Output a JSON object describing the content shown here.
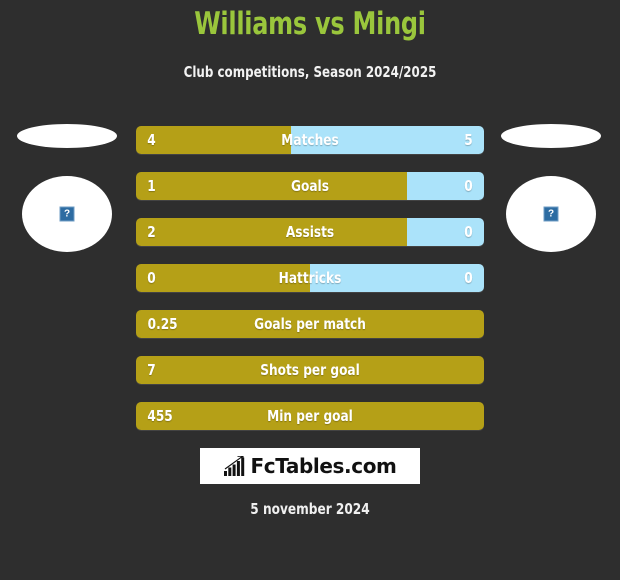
{
  "header": {
    "title": "Williams vs Mingi",
    "subtitle": "Club competitions, Season 2024/2025"
  },
  "colors": {
    "background": "#2e2e2e",
    "title_green": "#9ac63c",
    "bar_gold": "#b5a017",
    "bar_blue": "#abe3fa",
    "text_white": "#ffffff"
  },
  "players": {
    "left": {
      "image_status": "broken-image",
      "icon": "broken-image-icon"
    },
    "right": {
      "image_status": "broken-image",
      "icon": "broken-image-icon"
    }
  },
  "footer": {
    "logo_text": "FcTables.com",
    "logo_icon": "bar-chart-trend-icon",
    "date": "5 november 2024"
  },
  "chart_data": {
    "type": "bar",
    "title": "Williams vs Mingi",
    "subtitle": "Club competitions, Season 2024/2025",
    "orientation": "horizontal-diverging",
    "series": [
      {
        "name": "Williams",
        "color": "#b5a017",
        "side": "left"
      },
      {
        "name": "Mingi",
        "color": "#abe3fa",
        "side": "right"
      }
    ],
    "categories": [
      "Matches",
      "Goals",
      "Assists",
      "Hattricks",
      "Goals per match",
      "Shots per goal",
      "Min per goal"
    ],
    "rows": [
      {
        "label": "Matches",
        "left": "4",
        "right": "5",
        "left_pct": 44.4,
        "two_sided": true
      },
      {
        "label": "Goals",
        "left": "1",
        "right": "0",
        "left_pct": 78.0,
        "two_sided": true
      },
      {
        "label": "Assists",
        "left": "2",
        "right": "0",
        "left_pct": 78.0,
        "two_sided": true
      },
      {
        "label": "Hattricks",
        "left": "0",
        "right": "0",
        "left_pct": 50.0,
        "two_sided": true
      },
      {
        "label": "Goals per match",
        "left": "0.25",
        "right": "",
        "left_pct": 100,
        "two_sided": false
      },
      {
        "label": "Shots per goal",
        "left": "7",
        "right": "",
        "left_pct": 100,
        "two_sided": false
      },
      {
        "label": "Min per goal",
        "left": "455",
        "right": "",
        "left_pct": 100,
        "two_sided": false
      }
    ]
  }
}
